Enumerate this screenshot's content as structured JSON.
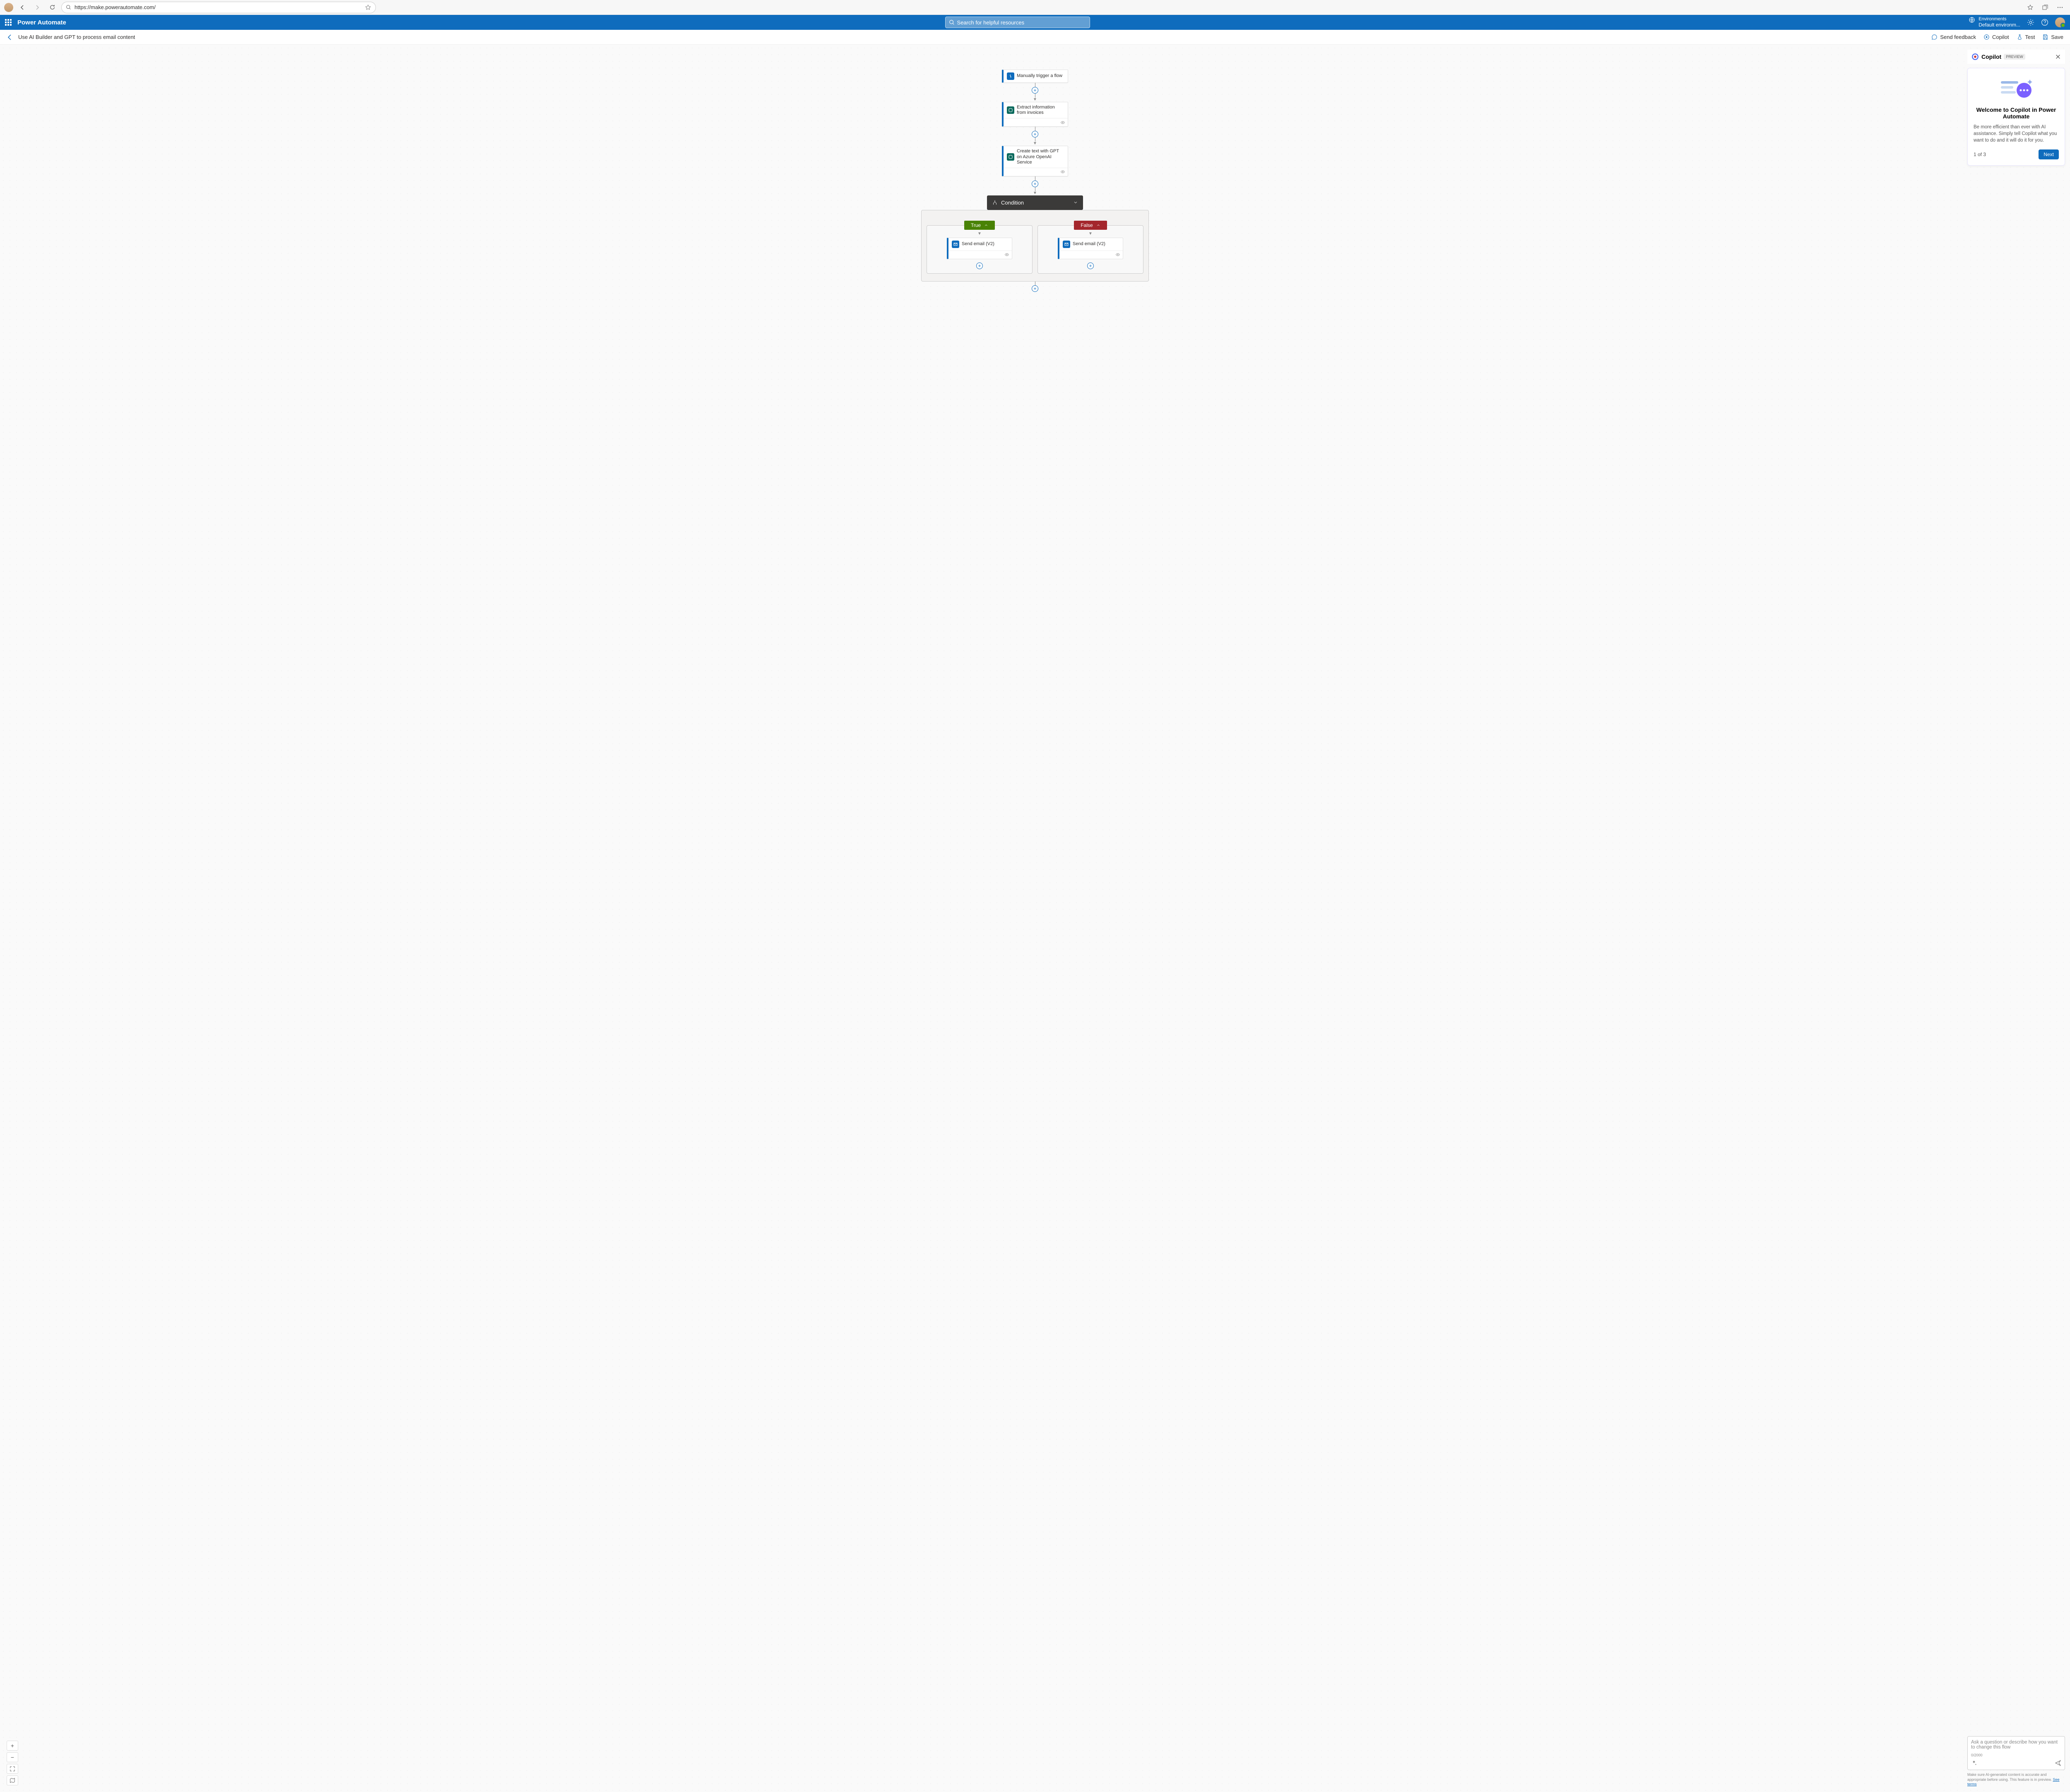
{
  "browser": {
    "url": "https://make.powerautomate.com/"
  },
  "header": {
    "app_name": "Power Automate",
    "search_placeholder": "Search for helpful resources",
    "env_label": "Environments",
    "env_name": "Default environm..."
  },
  "subheader": {
    "flow_title": "Use AI Builder and GPT to process email content",
    "actions": {
      "feedback": "Send feedback",
      "copilot": "Copilot",
      "test": "Test",
      "save": "Save"
    }
  },
  "flow": {
    "card1": "Manually trigger a flow",
    "card2": "Extract information from invoices",
    "card3": "Create text with GPT on Azure OpenAI Service",
    "condition": "Condition",
    "true_label": "True",
    "false_label": "False",
    "email_true": "Send email (V2)",
    "email_false": "Send email (V2)"
  },
  "copilot": {
    "title": "Copilot",
    "badge": "PREVIEW",
    "welcome_title": "Welcome to Copilot in Power Automate",
    "welcome_body": "Be more efficient than ever with AI assistance. Simply tell Copilot what you want to do and it will do it for you.",
    "step": "1 of 3",
    "next": "Next",
    "input_placeholder": "Ask a question or describe how you want to change this flow",
    "counter": "0/2000",
    "disclaimer": "Make sure AI-generated content is accurate and appropriate before using. This feature is in preview. ",
    "terms": "See terms"
  }
}
